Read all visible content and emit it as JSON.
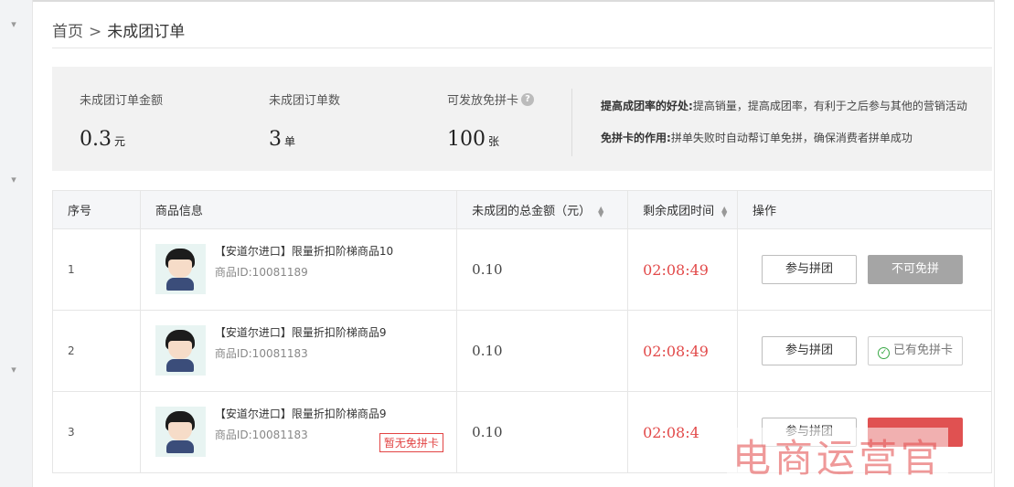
{
  "breadcrumb": {
    "home": "首页",
    "separator": ">",
    "current": "未成团订单"
  },
  "summary": {
    "stats": [
      {
        "label": "未成团订单金额",
        "value": "0.3",
        "unit": "元"
      },
      {
        "label": "未成团订单数",
        "value": "3",
        "unit": "单"
      },
      {
        "label": "可发放免拼卡",
        "value": "100",
        "unit": "张",
        "help_icon": "question-icon"
      }
    ],
    "tips": [
      {
        "title": "提高成团率的好处:",
        "text": "提高销量，提高成团率，有利于之后参与其他的营销活动"
      },
      {
        "title": "免拼卡的作用:",
        "text": "拼单失败时自动帮订单免拼，确保消费者拼单成功"
      }
    ]
  },
  "table": {
    "headers": [
      "序号",
      "商品信息",
      "未成团的总金额（元）",
      "剩余成团时间",
      "操作"
    ],
    "rows": [
      {
        "index": "1",
        "name": "【安道尔进口】限量折扣阶梯商品10",
        "product_id": "商品ID:10081189",
        "amount": "0.10",
        "time_left": "02:08:49",
        "join_label": "参与拼团",
        "second_action": "不可免拼",
        "second_state": "disabled"
      },
      {
        "index": "2",
        "name": "【安道尔进口】限量折扣阶梯商品9",
        "product_id": "商品ID:10081183",
        "amount": "0.10",
        "time_left": "02:08:49",
        "join_label": "参与拼团",
        "second_action": "已有免拼卡",
        "second_state": "has-card"
      },
      {
        "index": "3",
        "name": "【安道尔进口】限量折扣阶梯商品9",
        "product_id": "商品ID:10081183",
        "tag": "暂无免拼卡",
        "amount": "0.10",
        "time_left": "02:08:4",
        "join_label": "参与拼团",
        "second_action": "",
        "second_state": "red"
      }
    ]
  },
  "watermark": "电商运营官",
  "colors": {
    "timer": "#e24a4a",
    "tag": "#e24444",
    "disabled_button": "#a5a5a5",
    "summary_bg": "#f2f2f2"
  }
}
